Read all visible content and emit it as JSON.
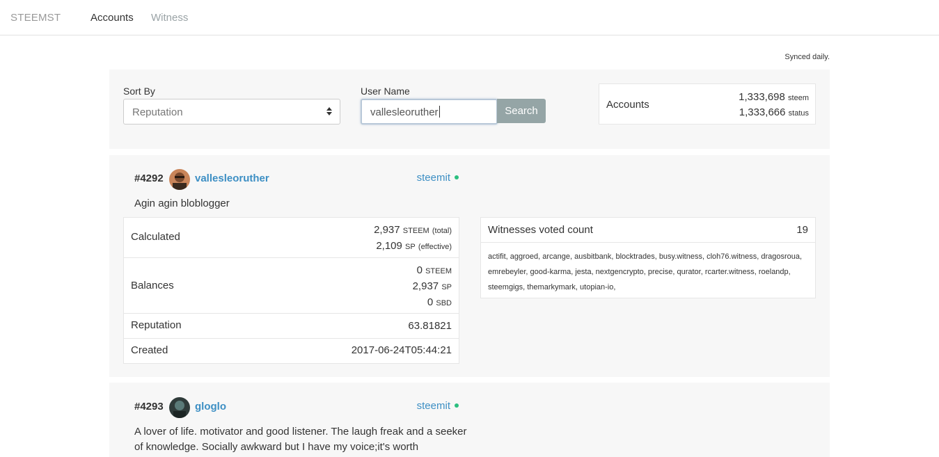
{
  "nav": {
    "brand": "STEEMST",
    "links": [
      {
        "label": "Accounts",
        "active": true
      },
      {
        "label": "Witness",
        "active": false
      }
    ]
  },
  "sync_note": "Synced daily.",
  "search": {
    "sort_label": "Sort By",
    "sort_value": "Reputation",
    "user_label": "User Name",
    "user_value": "vallesleoruther",
    "button_label": "Search"
  },
  "account_counts": {
    "label": "Accounts",
    "rows": [
      {
        "value": "1,333,698",
        "unit": "steem"
      },
      {
        "value": "1,333,666",
        "unit": "status"
      }
    ]
  },
  "results": [
    {
      "rank": "#4292",
      "username": "vallesleoruther",
      "source": "steemit",
      "about": "Agin agin bloblogger",
      "stats": {
        "calculated_label": "Calculated",
        "calculated": [
          {
            "value": "2,937",
            "unit": "STEEM",
            "note": "(total)"
          },
          {
            "value": "2,109",
            "unit": "SP",
            "note": "(effective)"
          }
        ],
        "balances_label": "Balances",
        "balances": [
          {
            "value": "0",
            "unit": "STEEM"
          },
          {
            "value": "2,937",
            "unit": "SP"
          },
          {
            "value": "0",
            "unit": "SBD"
          }
        ],
        "reputation_label": "Reputation",
        "reputation": "63.81821",
        "created_label": "Created",
        "created": "2017-06-24T05:44:21"
      },
      "witness": {
        "title": "Witnesses voted count",
        "count": "19",
        "list": "actifit, aggroed, arcange, ausbitbank, blocktrades, busy.witness, cloh76.witness, dragosroua, emrebeyler, good-karma, jesta, nextgencrypto, precise, qurator, rcarter.witness, roelandp, steemgigs, themarkymark, utopian-io,"
      }
    },
    {
      "rank": "#4293",
      "username": "gloglo",
      "source": "steemit",
      "about_lines": [
        "A lover of life. motivator and good listener. The laugh freak and a seeker",
        "of knowledge. Socially awkward but I have my voice;it's worth"
      ]
    }
  ],
  "colors": {
    "link": "#3d8fc4",
    "status_dot": "#2bbf7f",
    "search_button": "#95a5a6",
    "panel_bg": "#f7f7f7"
  }
}
